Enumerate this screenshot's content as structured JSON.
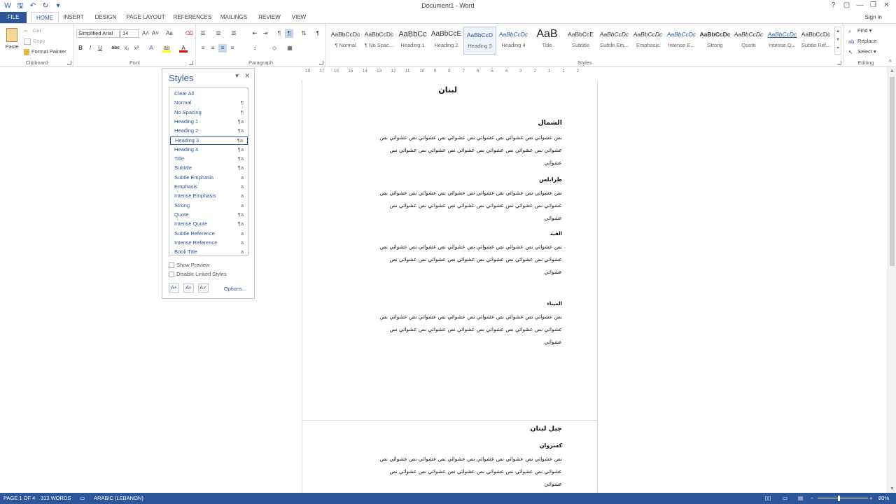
{
  "window": {
    "title": "Document1 - Word",
    "qat_icons": [
      "word-icon",
      "save-icon",
      "undo-icon",
      "redo-icon",
      "customize-icon"
    ],
    "controls": [
      "?",
      "▢",
      "—",
      "❐",
      "✕"
    ]
  },
  "tabs": {
    "file": "FILE",
    "items": [
      "HOME",
      "INSERT",
      "DESIGN",
      "PAGE LAYOUT",
      "REFERENCES",
      "MAILINGS",
      "REVIEW",
      "VIEW"
    ],
    "active": "HOME",
    "signin": "Sign in"
  },
  "ribbon": {
    "clipboard": {
      "label": "Clipboard",
      "paste": "Paste",
      "cut": "Cut",
      "copy": "Copy",
      "format_painter": "Format Painter"
    },
    "font": {
      "label": "Font",
      "font_name": "Simplified Arial",
      "font_size": "14",
      "buttons": [
        "B",
        "I",
        "U",
        "abc",
        "x₂",
        "x²"
      ]
    },
    "paragraph": {
      "label": "Paragraph"
    },
    "styles": {
      "label": "Styles",
      "gallery": [
        {
          "sample": "AaBbCcDc",
          "label": "¶ Normal"
        },
        {
          "sample": "AaBbCcDc",
          "label": "¶ No Spac..."
        },
        {
          "sample": "AaBbCc",
          "label": "Heading 1"
        },
        {
          "sample": "AaBbCcE",
          "label": "Heading 2"
        },
        {
          "sample": "AaBbCcD",
          "label": "Heading 3"
        },
        {
          "sample": "AaBbCcDc",
          "label": "Heading 4"
        },
        {
          "sample": "AaB",
          "label": "Title"
        },
        {
          "sample": "AaBbCcE",
          "label": "Subtitle"
        },
        {
          "sample": "AaBbCcDc",
          "label": "Subtle Em..."
        },
        {
          "sample": "AaBbCcDc",
          "label": "Emphasis"
        },
        {
          "sample": "AaBbCcDc",
          "label": "Intense E..."
        },
        {
          "sample": "AaBbCcDc",
          "label": "Strong"
        },
        {
          "sample": "AaBbCcDc",
          "label": "Quote"
        },
        {
          "sample": "AaBbCcDc",
          "label": "Intense Q..."
        },
        {
          "sample": "AaBbCcDc",
          "label": "Subtle Ref..."
        }
      ],
      "selected_index": 4
    },
    "editing": {
      "label": "Editing",
      "find": "Find",
      "replace": "Replace",
      "select": "Select"
    }
  },
  "ruler": {
    "ticks": [
      "18",
      "17",
      "16",
      "15",
      "14",
      "13",
      "12",
      "11",
      "10",
      "9",
      "8",
      "7",
      "6",
      "5",
      "4",
      "3",
      "2",
      "1",
      "1",
      "2"
    ]
  },
  "styles_pane": {
    "title": "Styles",
    "items": [
      {
        "name": "Clear All",
        "sym": ""
      },
      {
        "name": "Normal",
        "sym": "¶"
      },
      {
        "name": "No Spacing",
        "sym": "¶"
      },
      {
        "name": "Heading 1",
        "sym": "¶a"
      },
      {
        "name": "Heading 2",
        "sym": "¶a"
      },
      {
        "name": "Heading 3",
        "sym": "¶a"
      },
      {
        "name": "Heading 4",
        "sym": "¶a"
      },
      {
        "name": "Title",
        "sym": "¶a"
      },
      {
        "name": "Subtitle",
        "sym": "¶a"
      },
      {
        "name": "Subtle Emphasis",
        "sym": "a"
      },
      {
        "name": "Emphasis",
        "sym": "a"
      },
      {
        "name": "Intense Emphasis",
        "sym": "a"
      },
      {
        "name": "Strong",
        "sym": "a"
      },
      {
        "name": "Quote",
        "sym": "¶a"
      },
      {
        "name": "Intense Quote",
        "sym": "¶a"
      },
      {
        "name": "Subtle Reference",
        "sym": "a"
      },
      {
        "name": "Intense Reference",
        "sym": "a"
      },
      {
        "name": "Book Title",
        "sym": "a"
      }
    ],
    "selected_index": 5,
    "show_preview": "Show Preview",
    "disable_linked": "Disable Linked Styles",
    "options": "Options..."
  },
  "document": {
    "title": "لبنان",
    "sections": [
      {
        "heading": "الشمال",
        "level": "h1"
      },
      {
        "heading": "طرابلس",
        "level": "h2"
      },
      {
        "heading": "القبة",
        "level": "h3"
      },
      {
        "heading": "الميناء",
        "level": "h3"
      },
      {
        "heading": "جبل لبنان",
        "level": "h1"
      },
      {
        "heading": "كسروان",
        "level": "h2"
      }
    ],
    "body_line_1": "نص عشوائي نص عشوائي نص عشوائي نص عشوائي نص عشوائي نص عشوائي نص",
    "body_line_2": "عشوائي نص عشوائي نص عشوائي نص عشوائي نص عشوائي نص عشوائي نص",
    "body_line_3": "عشوائي"
  },
  "status": {
    "page": "PAGE 1 OF 4",
    "words": "313 WORDS",
    "language": "ARABIC (LEBANON)",
    "zoom": "80%"
  },
  "colors": {
    "accent": "#2b579a"
  }
}
